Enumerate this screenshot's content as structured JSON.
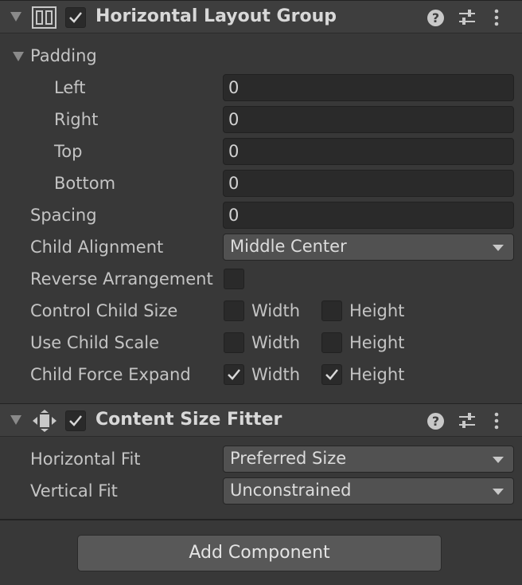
{
  "horizontal_layout_group": {
    "title": "Horizontal Layout Group",
    "enabled": true,
    "padding": {
      "label": "Padding",
      "left_label": "Left",
      "left": "0",
      "right_label": "Right",
      "right": "0",
      "top_label": "Top",
      "top": "0",
      "bottom_label": "Bottom",
      "bottom": "0"
    },
    "spacing_label": "Spacing",
    "spacing": "0",
    "child_alignment_label": "Child Alignment",
    "child_alignment": "Middle Center",
    "reverse_arrangement_label": "Reverse Arrangement",
    "reverse_arrangement": false,
    "control_child_size_label": "Control Child Size",
    "control_child_size": {
      "width_label": "Width",
      "width": false,
      "height_label": "Height",
      "height": false
    },
    "use_child_scale_label": "Use Child Scale",
    "use_child_scale": {
      "width_label": "Width",
      "width": false,
      "height_label": "Height",
      "height": false
    },
    "child_force_expand_label": "Child Force Expand",
    "child_force_expand": {
      "width_label": "Width",
      "width": true,
      "height_label": "Height",
      "height": true
    }
  },
  "content_size_fitter": {
    "title": "Content Size Fitter",
    "enabled": true,
    "horizontal_fit_label": "Horizontal Fit",
    "horizontal_fit": "Preferred Size",
    "vertical_fit_label": "Vertical Fit",
    "vertical_fit": "Unconstrained"
  },
  "add_component_label": "Add Component",
  "icons": {
    "help": "?",
    "foldout": "triangle-down-icon",
    "settings": "sliders-icon",
    "menu": "kebab-icon"
  }
}
